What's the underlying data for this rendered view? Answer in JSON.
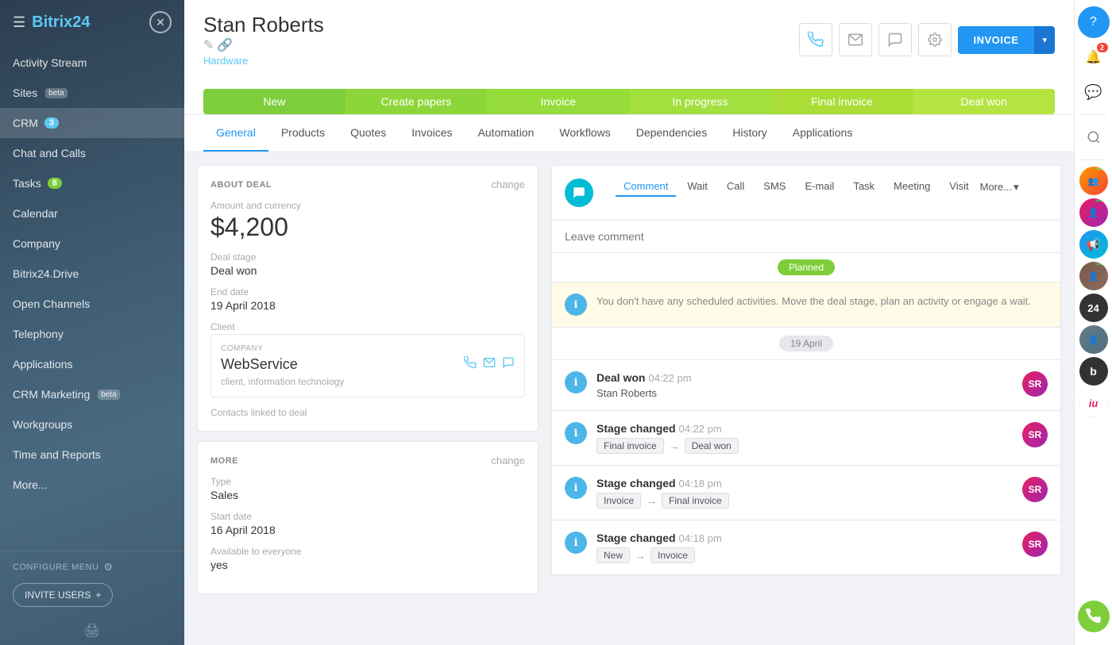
{
  "app": {
    "name": "Bitrix",
    "name_num": "24",
    "logo_close": "✕"
  },
  "sidebar": {
    "items": [
      {
        "id": "activity-stream",
        "label": "Activity Stream",
        "badge": null
      },
      {
        "id": "sites",
        "label": "Sites",
        "beta": true,
        "badge": null
      },
      {
        "id": "crm",
        "label": "CRM",
        "badge": "3",
        "active": true
      },
      {
        "id": "chat-calls",
        "label": "Chat and Calls",
        "badge": null
      },
      {
        "id": "tasks",
        "label": "Tasks",
        "badge": "8"
      },
      {
        "id": "calendar",
        "label": "Calendar",
        "badge": null
      },
      {
        "id": "company",
        "label": "Company",
        "badge": null
      },
      {
        "id": "bitrix24drive",
        "label": "Bitrix24.Drive",
        "badge": null
      },
      {
        "id": "open-channels",
        "label": "Open Channels",
        "badge": null
      },
      {
        "id": "telephony",
        "label": "Telephony",
        "badge": null
      },
      {
        "id": "applications",
        "label": "Applications",
        "badge": null
      },
      {
        "id": "crm-marketing",
        "label": "CRM Marketing",
        "beta": true,
        "badge": null
      },
      {
        "id": "workgroups",
        "label": "Workgroups",
        "badge": null
      },
      {
        "id": "time-reports",
        "label": "Time and Reports",
        "badge": null
      },
      {
        "id": "more",
        "label": "More...",
        "badge": null
      }
    ],
    "configure_menu": "CONFIGURE MENU",
    "invite_users": "INVITE USERS"
  },
  "header": {
    "title": "Stan Roberts",
    "subtitle": "Hardware",
    "invoice_btn": "INVOICE"
  },
  "stages": [
    {
      "id": "new",
      "label": "New"
    },
    {
      "id": "create-papers",
      "label": "Create papers"
    },
    {
      "id": "invoice",
      "label": "Invoice"
    },
    {
      "id": "in-progress",
      "label": "In progress"
    },
    {
      "id": "final-invoice",
      "label": "Final invoice"
    },
    {
      "id": "deal-won",
      "label": "Deal won"
    }
  ],
  "tabs": [
    {
      "id": "general",
      "label": "General",
      "active": true
    },
    {
      "id": "products",
      "label": "Products"
    },
    {
      "id": "quotes",
      "label": "Quotes"
    },
    {
      "id": "invoices",
      "label": "Invoices"
    },
    {
      "id": "automation",
      "label": "Automation"
    },
    {
      "id": "workflows",
      "label": "Workflows"
    },
    {
      "id": "dependencies",
      "label": "Dependencies"
    },
    {
      "id": "history",
      "label": "History"
    },
    {
      "id": "applications",
      "label": "Applications"
    }
  ],
  "about_deal": {
    "section_title": "ABOUT DEAL",
    "change_label": "change",
    "amount_label": "Amount and currency",
    "amount": "$4,200",
    "deal_stage_label": "Deal stage",
    "deal_stage": "Deal won",
    "end_date_label": "End date",
    "end_date": "19 April 2018",
    "client_label": "Client",
    "company_label": "COMPANY",
    "company_name": "WebService",
    "company_desc": "client, information technology",
    "contacts_label": "Contacts linked to deal"
  },
  "more_section": {
    "section_title": "MORE",
    "change_label": "change",
    "type_label": "Type",
    "type_value": "Sales",
    "start_date_label": "Start date",
    "start_date": "16 April 2018",
    "available_label": "Available to everyone",
    "available_value": "yes"
  },
  "activity": {
    "comment_tab": "Comment",
    "wait_tab": "Wait",
    "call_tab": "Call",
    "sms_tab": "SMS",
    "email_tab": "E-mail",
    "task_tab": "Task",
    "meeting_tab": "Meeting",
    "visit_tab": "Visit",
    "more_tab": "More...",
    "comment_placeholder": "Leave comment",
    "planned_label": "Planned",
    "info_text": "You don't have any scheduled activities. Move the deal stage, plan an activity or engage a wait.",
    "date_separator": "19 April",
    "items": [
      {
        "type": "deal_won",
        "title": "Deal won",
        "time": "04:22 pm",
        "subtitle": "Stan Roberts"
      },
      {
        "type": "stage_changed",
        "title": "Stage changed",
        "time": "04:22 pm",
        "from": "Final invoice",
        "to": "Deal won"
      },
      {
        "type": "stage_changed",
        "title": "Stage changed",
        "time": "04:18 pm",
        "from": "Invoice",
        "to": "Final invoice"
      },
      {
        "type": "stage_changed",
        "title": "Stage changed",
        "time": "04:18 pm",
        "from": "New",
        "to": "Invoice"
      }
    ]
  },
  "right_sidebar": {
    "help_icon": "?",
    "notification_badge": "2",
    "search_icon": "🔍",
    "phone_icon": "📞"
  }
}
